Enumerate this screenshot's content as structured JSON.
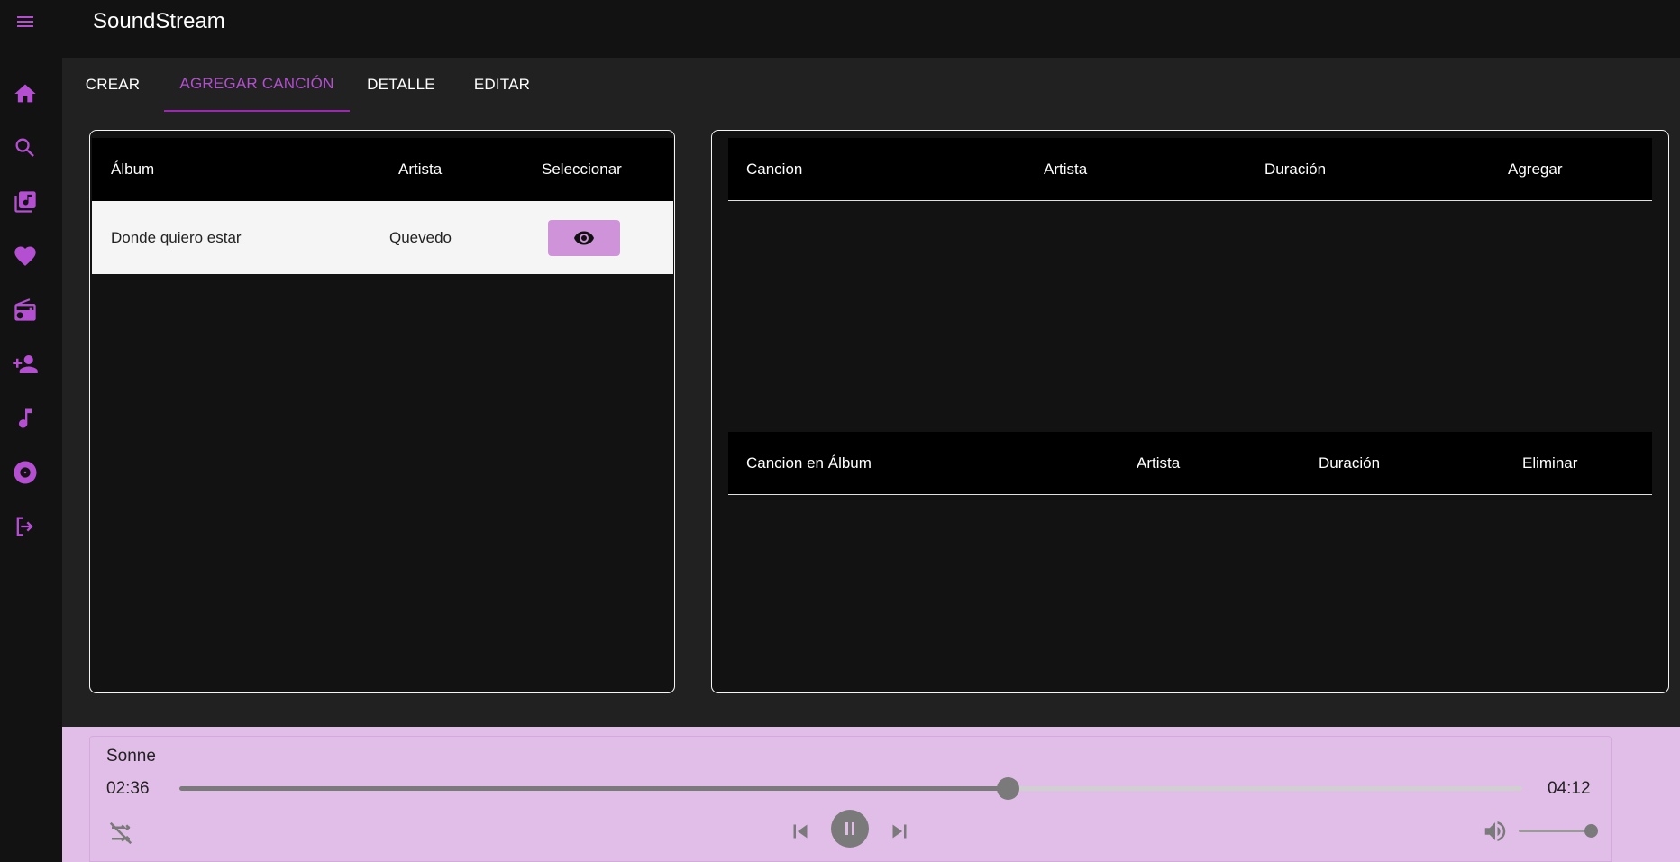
{
  "app": {
    "title": "SoundStream",
    "accent": "#b34fd0"
  },
  "sidebar": {
    "items": [
      {
        "icon": "home-icon"
      },
      {
        "icon": "search-icon"
      },
      {
        "icon": "library-music-icon"
      },
      {
        "icon": "heart-icon"
      },
      {
        "icon": "radio-icon"
      },
      {
        "icon": "add-person-icon"
      },
      {
        "icon": "music-note-icon"
      },
      {
        "icon": "album-icon"
      },
      {
        "icon": "logout-icon"
      }
    ]
  },
  "tabs": [
    {
      "label": "CREAR",
      "active": false
    },
    {
      "label": "AGREGAR CANCIÓN",
      "active": true
    },
    {
      "label": "DETALLE",
      "active": false
    },
    {
      "label": "EDITAR",
      "active": false
    }
  ],
  "albums_table": {
    "columns": [
      "Álbum",
      "Artista",
      "Seleccionar"
    ],
    "rows": [
      {
        "album": "Donde quiero estar",
        "artist": "Quevedo",
        "action_icon": "eye-icon"
      }
    ]
  },
  "songs_table": {
    "columns": [
      "Cancion",
      "Artista",
      "Duración",
      "Agregar"
    ]
  },
  "album_songs_table": {
    "columns": [
      "Cancion en Álbum",
      "Artista",
      "Duración",
      "Eliminar"
    ]
  },
  "player": {
    "song": "Sonne",
    "elapsed": "02:36",
    "total": "04:12",
    "progress": 0.617,
    "volume": 0.95,
    "state": "playing"
  }
}
